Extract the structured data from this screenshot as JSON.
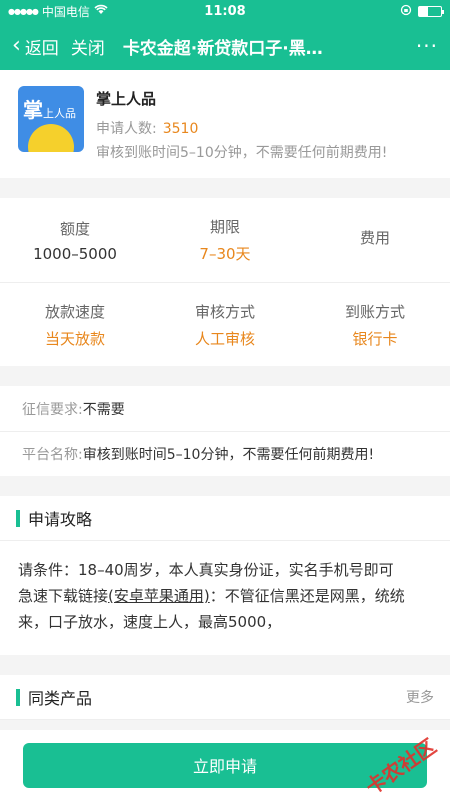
{
  "status_bar": {
    "carrier": "中国电信",
    "time": "11:08"
  },
  "nav": {
    "back_label": "返回",
    "close_label": "关闭",
    "title": "卡农金超·新贷款口子·黑…",
    "more_label": "···"
  },
  "product": {
    "logo_text": "掌",
    "logo_small": "上人品",
    "name": "掌上人品",
    "count_label": "申请人数:",
    "count_value": "3510",
    "desc": "审核到账时间5–10分钟，不需要任何前期费用!"
  },
  "grid": [
    [
      {
        "key": "额度",
        "value": "1000–5000",
        "orange": false
      },
      {
        "key": "期限",
        "value": "7–30天",
        "orange": true
      },
      {
        "key": "费用",
        "value": "",
        "orange": false
      }
    ],
    [
      {
        "key": "放款速度",
        "value": "当天放款",
        "orange": true
      },
      {
        "key": "审核方式",
        "value": "人工审核",
        "orange": true
      },
      {
        "key": "到账方式",
        "value": "银行卡",
        "orange": true
      }
    ]
  ],
  "info": [
    {
      "key": "征信要求:",
      "value": "不需要"
    },
    {
      "key": "平台名称:",
      "value": "审核到账时间5–10分钟，不需要任何前期费用!"
    }
  ],
  "guide": {
    "title": "申请攻略",
    "line1": "请条件：18–40周岁，本人真实身份证，实名手机号即可",
    "line2_pre": "急速下载链接",
    "line2_link": "(安卓苹果通用)",
    "line2_post": "：不管征信黑还是网黑，统统来，口子放水，速度上人，最高5000，"
  },
  "similar": {
    "title": "同类产品",
    "more": "更多"
  },
  "apply_label": "立即申请",
  "watermark": "卡农社区",
  "colors": {
    "brand": "#19bf93",
    "accent": "#e8871d"
  }
}
